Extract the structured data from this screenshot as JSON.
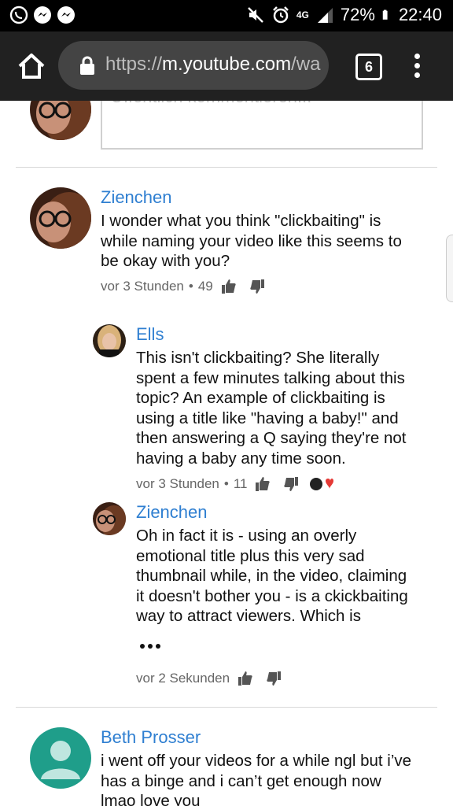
{
  "status": {
    "network": "4G",
    "battery": "72%",
    "time": "22:40"
  },
  "browser": {
    "url_prefix": "https://",
    "url_host": "m.youtube.com",
    "url_rest": "/wa",
    "tab_count": "6"
  },
  "compose": {
    "placeholder": "Öffentlich kommentieren..."
  },
  "comments": [
    {
      "author": "Zienchen",
      "text": "I wonder what you think \"clickbaiting\" is while naming your video like this seems to be okay with you?",
      "time": "vor 3 Stunden",
      "likes": "49"
    },
    {
      "author": "Ells",
      "text": "This isn't clickbaiting? She literally spent a few minutes talking about this topic? An example of clickbaiting is using a title like \"having a baby!\" and then answering a Q saying they're not having a baby any time soon.",
      "time": "vor 3 Stunden",
      "likes": "11"
    },
    {
      "author": "Zienchen",
      "text": "Oh in fact it is - using an overly emotional title plus this very sad thumbnail while, in the video, claiming it doesn't bother you - is a ckickbaiting way to attract viewers. Which is",
      "time": "vor 2 Sekunden"
    },
    {
      "author": "Beth Prosser",
      "text": "i went off your videos for a while ngl but i’ve has a binge and i can’t get enough now lmao love you"
    }
  ]
}
